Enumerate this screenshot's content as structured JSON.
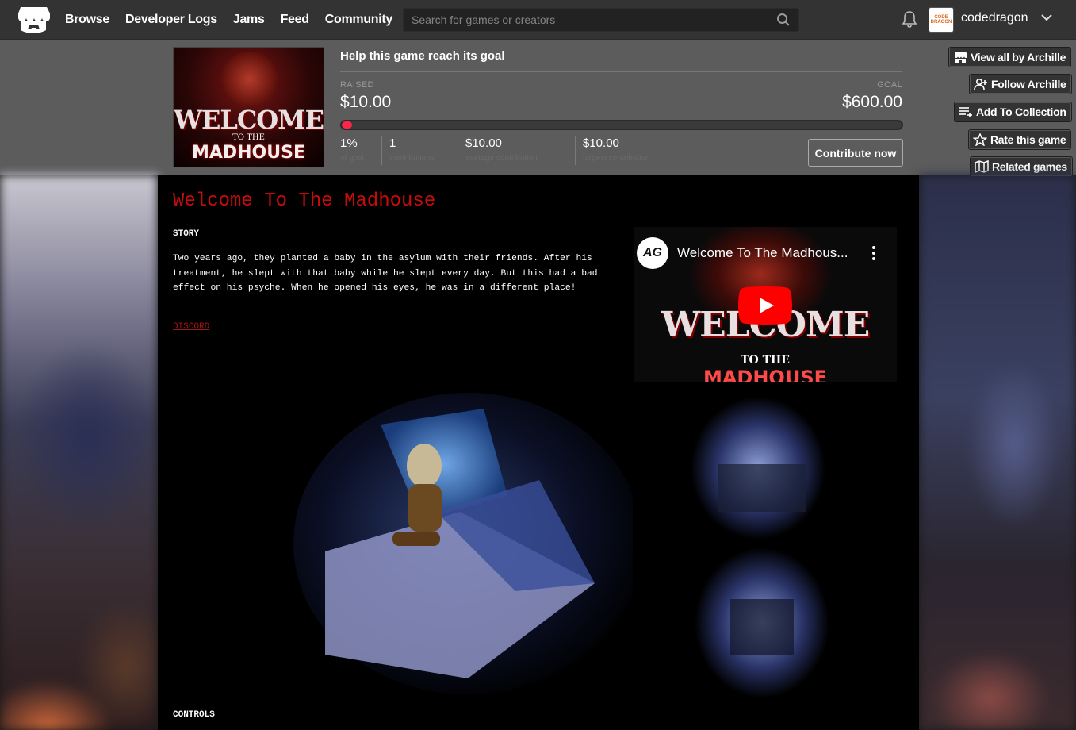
{
  "nav": {
    "links": [
      "Browse",
      "Developer Logs",
      "Jams",
      "Feed",
      "Community"
    ],
    "search_placeholder": "Search for games or creators",
    "avatar_text": "CODE DRAGON",
    "username": "codedragon"
  },
  "goal": {
    "title": "Help this game reach its goal",
    "raised_label": "RAISED",
    "raised_value": "$10.00",
    "goal_label": "GOAL",
    "goal_value": "$600.00",
    "progress_fraction": 0.0167,
    "stats": [
      {
        "value": "1%",
        "label": "of goal"
      },
      {
        "value": "1",
        "label": "contributions"
      },
      {
        "value": "$10.00",
        "label": "average contribution"
      },
      {
        "value": "$10.00",
        "label": "largest contribution"
      }
    ],
    "contribute_label": "Contribute now"
  },
  "cover": {
    "line1": "WELCOME",
    "line2": "TO THE",
    "line3": "MADHOUSE"
  },
  "actions": [
    {
      "label": "View all by Archille",
      "icon": "store-icon"
    },
    {
      "label": "Follow Archille",
      "icon": "follow-user-icon"
    },
    {
      "label": "Add To Collection",
      "icon": "collection-add-icon"
    },
    {
      "label": "Rate this game",
      "icon": "star-icon"
    },
    {
      "label": "Related games",
      "icon": "map-icon"
    }
  ],
  "page": {
    "title": "Welcome To The Madhouse",
    "story_heading": "STORY",
    "story_text": "Two years ago, they planted a baby in the asylum with their friends. After his treatment, he slept with that baby while he slept every day. But this had a bad effect on his psyche. When he opened his eyes, he was in a different place!",
    "discord_link": "DISCORD",
    "controls_heading": "CONTROLS"
  },
  "video": {
    "title": "Welcome To The Madhous...",
    "channel_initials": "AG",
    "thumb_line1": "WELCOME",
    "thumb_line2": "TO THE",
    "thumb_line3": "MADHOUSE"
  },
  "colors": {
    "nav_bg": "#333333",
    "header_bg": "#5c5c5c",
    "title_red": "#c90b0b",
    "progress_fill": "#ff2449",
    "main_bg": "#000000"
  }
}
